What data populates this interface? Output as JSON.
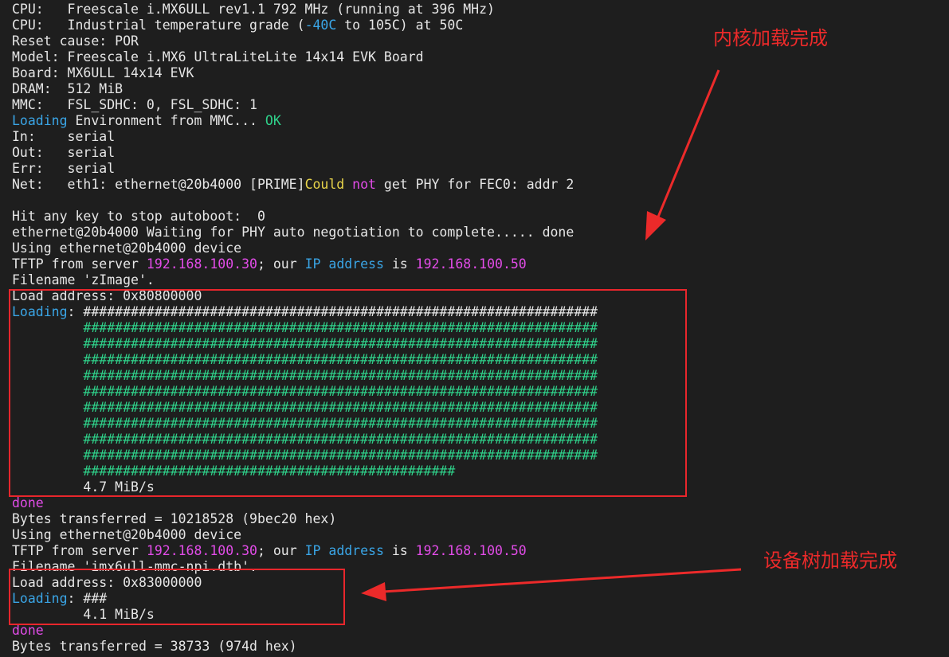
{
  "colors": {
    "background": "#1e1e1e",
    "text": "#e6e6e6",
    "cyan": "#3aa5e6",
    "green": "#2fd18a",
    "magenta": "#e24ce8",
    "yellow": "#e8d44a",
    "annotation_red": "#ec2a2a"
  },
  "terminal": {
    "lines": [
      [
        {
          "t": "CPU:   Freescale i.MX6ULL rev1.1 792 MHz (running at 396 MHz)",
          "c": "white"
        }
      ],
      [
        {
          "t": "CPU:   Industrial temperature grade (",
          "c": "white"
        },
        {
          "t": "-40C",
          "c": "cyan"
        },
        {
          "t": " to 105C) at 50C",
          "c": "white"
        }
      ],
      [
        {
          "t": "Reset cause: POR",
          "c": "white"
        }
      ],
      [
        {
          "t": "Model: Freescale i.MX6 UltraLiteLite 14x14 EVK Board",
          "c": "white"
        }
      ],
      [
        {
          "t": "Board: MX6ULL 14x14 EVK",
          "c": "white"
        }
      ],
      [
        {
          "t": "DRAM:  512 MiB",
          "c": "white"
        }
      ],
      [
        {
          "t": "MMC:   FSL_SDHC: 0, FSL_SDHC: 1",
          "c": "white"
        }
      ],
      [
        {
          "t": "Loading",
          "c": "cyan"
        },
        {
          "t": " Environment from MMC... ",
          "c": "white"
        },
        {
          "t": "OK",
          "c": "green"
        }
      ],
      [
        {
          "t": "In:    serial",
          "c": "white"
        }
      ],
      [
        {
          "t": "Out:   serial",
          "c": "white"
        }
      ],
      [
        {
          "t": "Err:   serial",
          "c": "white"
        }
      ],
      [
        {
          "t": "Net:   eth1: ethernet@20b4000 [PRIME]",
          "c": "white"
        },
        {
          "t": "Could ",
          "c": "yellow"
        },
        {
          "t": "not",
          "c": "magenta"
        },
        {
          "t": " get PHY for FEC0: addr 2",
          "c": "white"
        }
      ],
      [
        {
          "t": "",
          "c": "white"
        }
      ],
      [
        {
          "t": "Hit any key to stop autoboot:  0",
          "c": "white"
        }
      ],
      [
        {
          "t": "ethernet@20b4000 Waiting for PHY auto negotiation to complete..... done",
          "c": "white"
        }
      ],
      [
        {
          "t": "Using ethernet@20b4000 device",
          "c": "white"
        }
      ],
      [
        {
          "t": "TFTP from server ",
          "c": "white"
        },
        {
          "t": "192.168.100.30",
          "c": "magenta"
        },
        {
          "t": "; our ",
          "c": "white"
        },
        {
          "t": "IP address",
          "c": "cyan"
        },
        {
          "t": " is ",
          "c": "white"
        },
        {
          "t": "192.168.100.50",
          "c": "magenta"
        }
      ],
      [
        {
          "t": "Filename 'zImage'.",
          "c": "white"
        }
      ],
      [
        {
          "t": "Load address: 0x80800000",
          "c": "white"
        }
      ],
      [
        {
          "t": "Loading",
          "c": "cyan"
        },
        {
          "t": ": #################################################################",
          "c": "white"
        }
      ],
      [
        {
          "t": "         #################################################################",
          "c": "green"
        }
      ],
      [
        {
          "t": "         #################################################################",
          "c": "green"
        }
      ],
      [
        {
          "t": "         #################################################################",
          "c": "green"
        }
      ],
      [
        {
          "t": "         #################################################################",
          "c": "green"
        }
      ],
      [
        {
          "t": "         #################################################################",
          "c": "green"
        }
      ],
      [
        {
          "t": "         #################################################################",
          "c": "green"
        }
      ],
      [
        {
          "t": "         #################################################################",
          "c": "green"
        }
      ],
      [
        {
          "t": "         #################################################################",
          "c": "green"
        }
      ],
      [
        {
          "t": "         #################################################################",
          "c": "green"
        }
      ],
      [
        {
          "t": "         ###############################################",
          "c": "green"
        }
      ],
      [
        {
          "t": "         4.7 MiB/s",
          "c": "white"
        }
      ],
      [
        {
          "t": "done",
          "c": "magenta"
        }
      ],
      [
        {
          "t": "Bytes transferred = 10218528 (9bec20 hex)",
          "c": "white"
        }
      ],
      [
        {
          "t": "Using ethernet@20b4000 device",
          "c": "white"
        }
      ],
      [
        {
          "t": "TFTP from server ",
          "c": "white"
        },
        {
          "t": "192.168.100.30",
          "c": "magenta"
        },
        {
          "t": "; our ",
          "c": "white"
        },
        {
          "t": "IP address",
          "c": "cyan"
        },
        {
          "t": " is ",
          "c": "white"
        },
        {
          "t": "192.168.100.50",
          "c": "magenta"
        }
      ],
      [
        {
          "t": "Filename 'imx6ull-mmc-npi.dtb'.",
          "c": "white"
        }
      ],
      [
        {
          "t": "Load address: 0x83000000",
          "c": "white"
        }
      ],
      [
        {
          "t": "Loading",
          "c": "cyan"
        },
        {
          "t": ": ###",
          "c": "white"
        }
      ],
      [
        {
          "t": "         4.1 MiB/s",
          "c": "white"
        }
      ],
      [
        {
          "t": "done",
          "c": "magenta"
        }
      ],
      [
        {
          "t": "Bytes transferred = 38733 (974d hex)",
          "c": "white"
        }
      ]
    ]
  },
  "annotations": {
    "kernel_loaded": "内核加载完成",
    "dtb_loaded": "设备树加载完成"
  }
}
